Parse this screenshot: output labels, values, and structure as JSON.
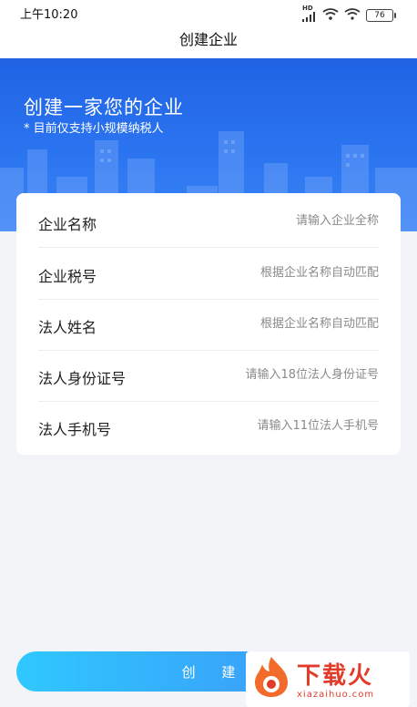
{
  "status_bar": {
    "time": "上午10:20",
    "hd_label": "HD",
    "battery": "76"
  },
  "nav": {
    "title": "创建企业"
  },
  "hero": {
    "title": "创建一家您的企业",
    "subtitle": "* 目前仅支持小规模纳税人"
  },
  "form": {
    "rows": [
      {
        "label": "企业名称",
        "placeholder": "请输入企业全称"
      },
      {
        "label": "企业税号",
        "placeholder": "根据企业名称自动匹配"
      },
      {
        "label": "法人姓名",
        "placeholder": "根据企业名称自动匹配"
      },
      {
        "label": "法人身份证号",
        "placeholder": "请输入18位法人身份证号"
      },
      {
        "label": "法人手机号",
        "placeholder": "请输入11位法人手机号"
      }
    ]
  },
  "create_button": "创 建",
  "watermark": {
    "brand": "下载火",
    "url": "xiazaihuo.com"
  },
  "colors": {
    "hero_blue": "#1f63e4",
    "button_start": "#2fc8ff",
    "button_end": "#3f8cf6"
  }
}
